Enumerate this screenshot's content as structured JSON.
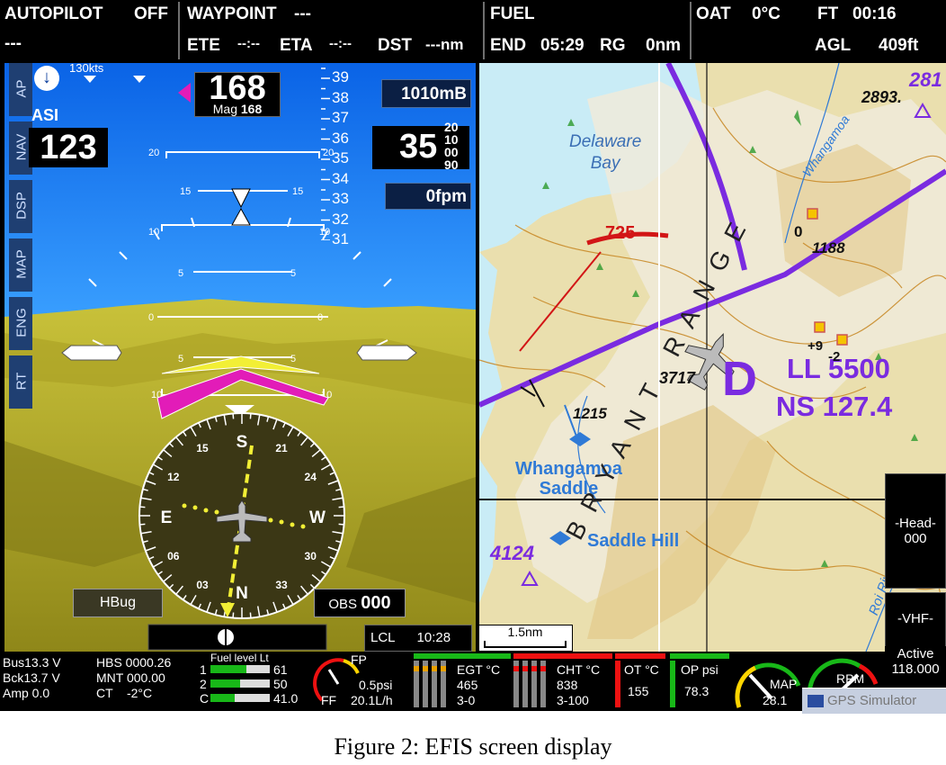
{
  "header": {
    "autopilot_label": "AUTOPILOT",
    "autopilot_state": "OFF",
    "autopilot_sub": "---",
    "waypoint_label": "WAYPOINT",
    "waypoint_value": "---",
    "ete_label": "ETE",
    "ete_value": "--:--",
    "eta_label": "ETA",
    "eta_value": "--:--",
    "dst_label": "DST",
    "dst_value": "---nm",
    "fuel_label": "FUEL",
    "end_label": "END",
    "end_value": "05:29",
    "rg_label": "RG",
    "rg_value": "0nm",
    "oat_label": "OAT",
    "oat_value": "0°C",
    "ft_label": "FT",
    "ft_value": "00:16",
    "agl_label": "AGL",
    "agl_value": "409ft"
  },
  "side_tabs": [
    "AP",
    "NAV",
    "DSP",
    "MAP",
    "ENG",
    "RT"
  ],
  "pfd": {
    "speed_bug": "130kts",
    "asi_label": "ASI",
    "airspeed": "123",
    "heading": "168",
    "mag_label": "Mag",
    "mag_value": "168",
    "baro": "1010mB",
    "altitude_main": "35",
    "altitude_digits": [
      "20",
      "10",
      "00",
      "90"
    ],
    "vsi": "0fpm",
    "alt_tape": [
      "39",
      "38",
      "37",
      "36",
      "35",
      "34",
      "33",
      "32",
      "31"
    ],
    "pitch_labels": [
      "20",
      "15",
      "10",
      "5",
      "0",
      "5",
      "10"
    ],
    "compass_labels": [
      "S",
      "21",
      "24",
      "W",
      "30",
      "33",
      "N",
      "03",
      "06",
      "E",
      "12",
      "15"
    ],
    "hbug_label": "HBug",
    "obs_label": "OBS",
    "obs_value": "000",
    "lcl_label": "LCL",
    "lcl_time": "10:28"
  },
  "map": {
    "labels": {
      "bay": "Delaware\nBay",
      "elev_2893": "2893.",
      "elev_281": "281",
      "elev_1188": "1188",
      "elev_0": "0",
      "elev_3717": "3717",
      "elev_1215": "1215",
      "saddle": "Whangamoa\nSaddle",
      "saddle_hill": "Saddle Hill",
      "elev_4124": "4124",
      "range": "BRYANT RANGE",
      "airspace_d": "D",
      "ll": "LL 5500",
      "ns": "NS 127.4",
      "alt_725": "725",
      "plus9": "+9",
      "minus2": "-2",
      "river": "Roi River",
      "stream": "Whangamoa"
    },
    "scale": "1.5nm",
    "head_btn_label": "-Head-",
    "head_btn_value": "000",
    "vhf_label": "-VHF-",
    "vhf_state": "Active",
    "vhf_freq": "118.000"
  },
  "engine": {
    "bus": "Bus13.3 V",
    "bck": "Bck13.7 V",
    "amp": "Amp 0.0",
    "hbs": "HBS 0000.26",
    "mnt": "MNT 000.00",
    "ct": "CT    -2°C",
    "fuel_title": "Fuel level Lt",
    "fuel_tanks": [
      {
        "id": "1",
        "value": "61",
        "frac": 0.61
      },
      {
        "id": "2",
        "value": "50",
        "frac": 0.5
      },
      {
        "id": "C",
        "value": "41.0",
        "frac": 0.41
      }
    ],
    "fp_label": "FP",
    "fp_value": "0.5psi",
    "ff_label": "FF",
    "ff_value": "20.1L/h",
    "egt_label": "EGT °C",
    "egt_value": "465",
    "egt_sub": "3-0",
    "cht_label": "CHT °C",
    "cht_value": "838",
    "cht_sub": "3-100",
    "ot_label": "OT °C",
    "ot_value": "155",
    "op_label": "OP psi",
    "op_value": "78.3",
    "map_label": "MAP",
    "map_value": "28.1",
    "rpm_label": "RPM",
    "gps_sim": "GPS Simulator"
  },
  "caption": "Figure 2: EFIS screen display",
  "colors": {
    "sky": "#1e90ff",
    "ground": "#b9ad2a",
    "magenta": "#e21cb8",
    "airspace": "#7a2be0",
    "pfd_box": "#0b1f44"
  }
}
